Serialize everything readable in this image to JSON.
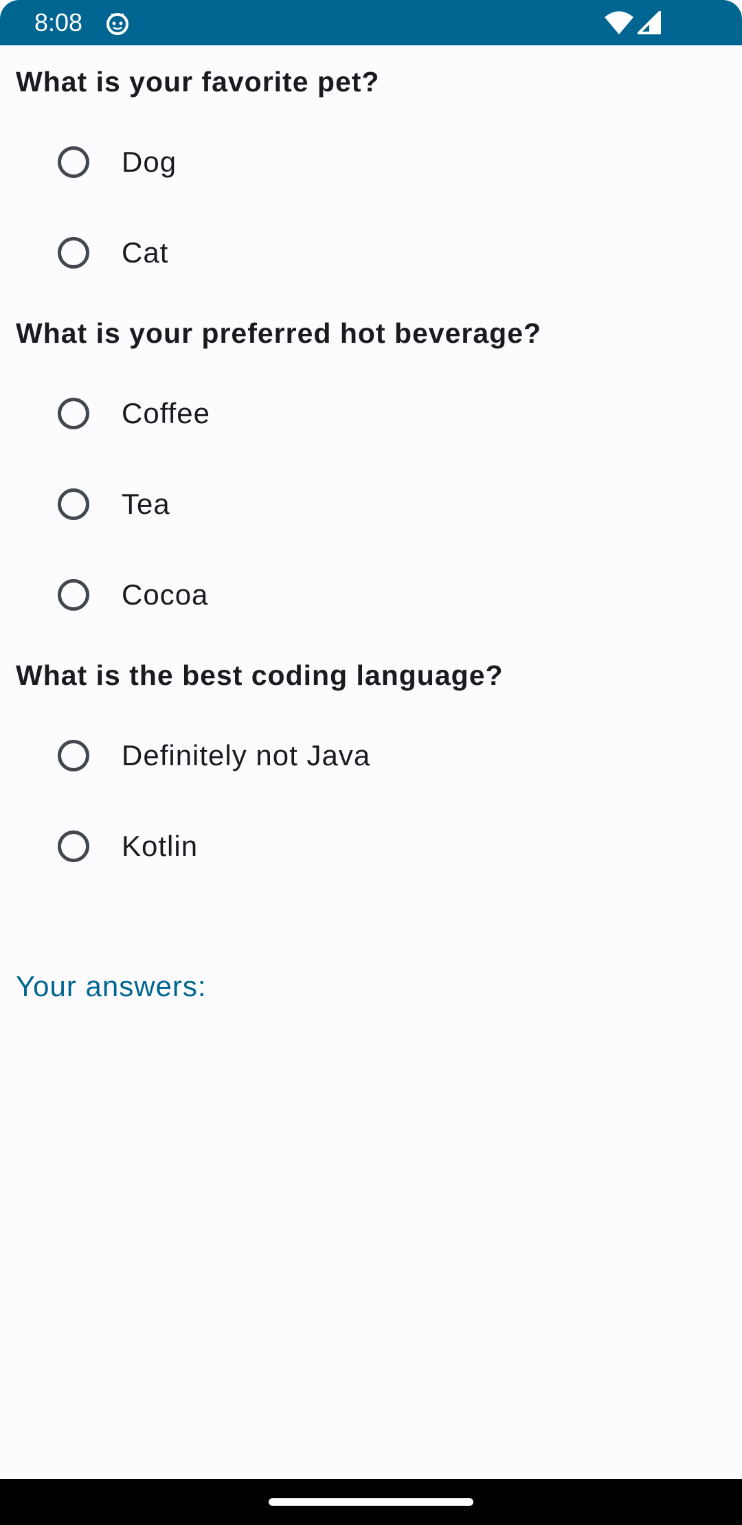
{
  "status_bar": {
    "time": "8:08",
    "app_icon": "cat-face-icon",
    "wifi_icon": "wifi-icon",
    "signal_icon": "cell-signal-icon",
    "background": "#006590"
  },
  "questions": [
    {
      "text": "What is your favorite pet?",
      "options": [
        {
          "label": "Dog",
          "selected": false
        },
        {
          "label": "Cat",
          "selected": false
        }
      ]
    },
    {
      "text": "What is your preferred hot beverage?",
      "options": [
        {
          "label": "Coffee",
          "selected": false
        },
        {
          "label": "Tea",
          "selected": false
        },
        {
          "label": "Cocoa",
          "selected": false
        }
      ]
    },
    {
      "text": "What is the best coding language?",
      "options": [
        {
          "label": "Definitely not Java",
          "selected": false
        },
        {
          "label": "Kotlin",
          "selected": false
        }
      ]
    }
  ],
  "answers": {
    "label": "Your answers:",
    "color": "#006590"
  },
  "colors": {
    "background": "#fcfcff",
    "text": "#1b1b1f",
    "radio": "#43474e"
  }
}
